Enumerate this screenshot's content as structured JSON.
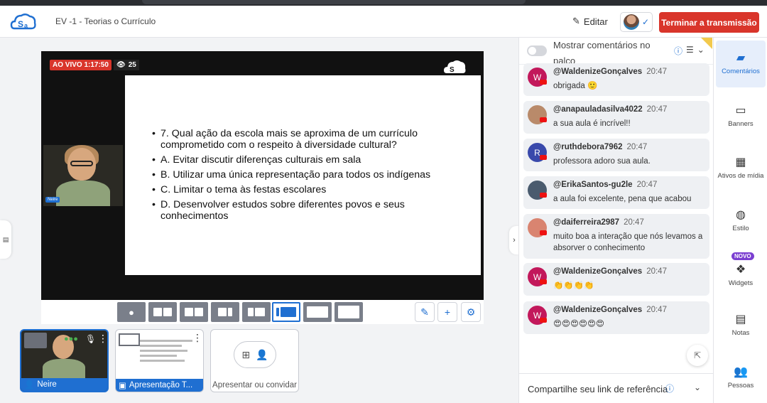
{
  "header": {
    "title": "EV -1 - Teorias o Currículo",
    "edit_label": "Editar",
    "end_label": "Terminar a transmissão"
  },
  "stage": {
    "live_label": "AO VIVO 1:17:50",
    "viewers": "25",
    "camera_name": "Neire",
    "slide_items": [
      "7. Qual ação da escola mais se aproxima de um currículo comprometido com o respeito à diversidade cultural?",
      "A. Evitar discutir diferenças culturais em sala",
      "B. Utilizar uma única representação para todos os indígenas",
      "C. Limitar o tema às festas escolares",
      "D. Desenvolver estudos sobre diferentes povos e seus conhecimentos"
    ]
  },
  "thumbnails": {
    "camera_label": "Neire",
    "presentation_label": "Apresentação T...",
    "invite_label": "Apresentar ou convidar"
  },
  "chat": {
    "show_on_stage_label": "Mostrar comentários no palco",
    "referral_label": "Compartilhe seu link de referência",
    "messages": [
      {
        "user": "@WaldenizeGonçalves",
        "time": "20:47",
        "text": "obrigada 🙂",
        "initial": "W",
        "color": "#c2185b"
      },
      {
        "user": "@anapauladasilva4022",
        "time": "20:47",
        "text": "a sua aula é incrível!!",
        "initial": "",
        "color": "#b98a6a"
      },
      {
        "user": "@ruthdebora7962",
        "time": "20:47",
        "text": "professora adoro sua aula.",
        "initial": "R",
        "color": "#3949ab"
      },
      {
        "user": "@ErikaSantos-gu2le",
        "time": "20:47",
        "text": "a aula foi excelente, pena que acabou",
        "initial": "",
        "color": "#4a5b6e"
      },
      {
        "user": "@daiferreira2987",
        "time": "20:47",
        "text": "muito boa a interação que nós levamos a absorver o conhecimento",
        "initial": "",
        "color": "#d98470"
      },
      {
        "user": "@WaldenizeGonçalves",
        "time": "20:47",
        "text": "👏👏👏👏",
        "initial": "W",
        "color": "#c2185b"
      },
      {
        "user": "@WaldenizeGonçalves",
        "time": "20:47",
        "text": "😍😍😍😍😍😍",
        "initial": "W",
        "color": "#c2185b"
      }
    ]
  },
  "rail": {
    "items": [
      "Comentários",
      "Banners",
      "Ativos de mídia",
      "Estilo",
      "Widgets",
      "Notas",
      "Pessoas"
    ],
    "novo_badge": "NOVO"
  }
}
